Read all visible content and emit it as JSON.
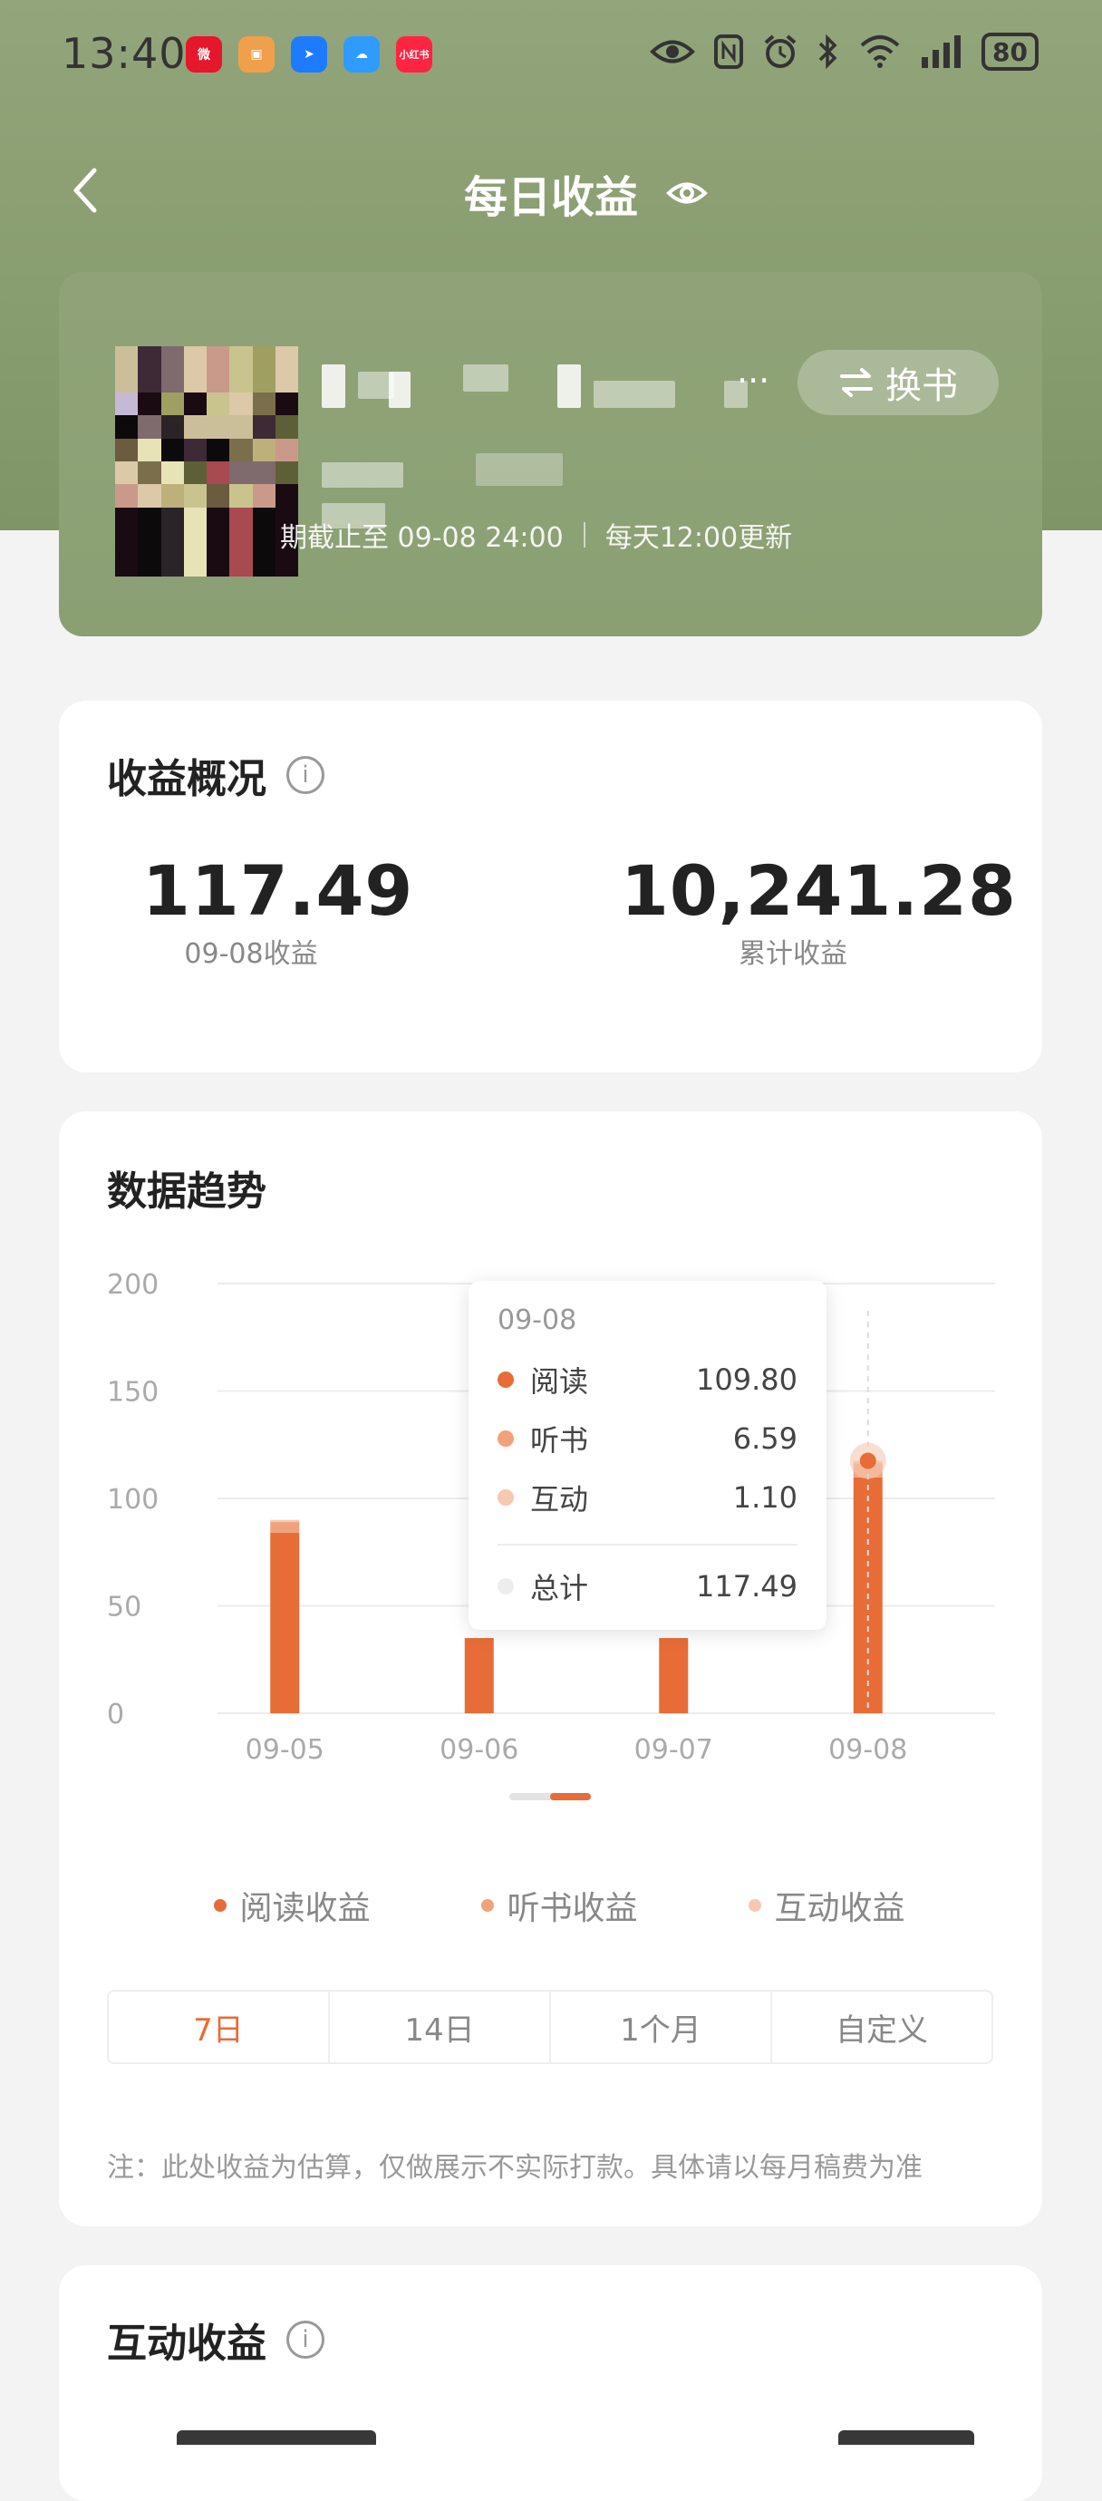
{
  "status_bar": {
    "time": "13:40",
    "battery": "80",
    "apps": [
      {
        "icon": "weibo-icon",
        "color": "#e6162d"
      },
      {
        "icon": "chat-bot-icon",
        "color": "#f0a04b"
      },
      {
        "icon": "bookmark-app-icon",
        "color": "#1e7bff"
      },
      {
        "icon": "cloud-icon",
        "color": "#2f9bff"
      },
      {
        "icon": "xiaohongshu-icon",
        "color": "#ff2442"
      }
    ],
    "indicators": [
      "eye-icon",
      "nfc-icon",
      "alarm-icon",
      "bluetooth-icon",
      "wifi-icon",
      "signal-icon"
    ]
  },
  "header": {
    "title": "每日收益"
  },
  "book": {
    "switch_label": "换书",
    "dots": "···",
    "data_cutoff": "期截止至 09-08 24:00",
    "update_note": "每天12:00更新"
  },
  "overview": {
    "title": "收益概况",
    "info": "i",
    "daily_value": "117.49",
    "daily_label": "09-08收益",
    "total_value": "10,241.28",
    "total_label": "累计收益"
  },
  "trend": {
    "title": "数据趋势",
    "tooltip": {
      "date": "09-08",
      "rows": [
        {
          "label": "阅读",
          "value": "109.80",
          "color": "#e86c37"
        },
        {
          "label": "听书",
          "value": "6.59",
          "color": "#f0a27a"
        },
        {
          "label": "互动",
          "value": "1.10",
          "color": "#f6c8b0"
        }
      ],
      "total_label": "总计",
      "total_value": "117.49",
      "total_color": "#ededed"
    },
    "legend": [
      {
        "label": "阅读收益",
        "color": "#e86c37"
      },
      {
        "label": "听书收益",
        "color": "#f0a27a"
      },
      {
        "label": "互动收益",
        "color": "#f6c8b0"
      }
    ],
    "tabs": [
      "7日",
      "14日",
      "1个月",
      "自定义"
    ],
    "active_tab": 0,
    "note": "注：此处收益为估算，仅做展示不实际打款。具体请以每月稿费为准"
  },
  "chart_data": {
    "type": "bar",
    "stacked": true,
    "categories": [
      "09-05",
      "09-06",
      "09-07",
      "09-08"
    ],
    "series": [
      {
        "name": "阅读收益",
        "values": [
          84,
          35,
          35,
          109.8
        ],
        "color": "#e86c37"
      },
      {
        "name": "听书收益",
        "values": [
          5,
          0,
          0,
          6.59
        ],
        "color": "#f0a27a"
      },
      {
        "name": "互动收益",
        "values": [
          1,
          0,
          0,
          1.1
        ],
        "color": "#f6c8b0"
      }
    ],
    "ylim": [
      0,
      200
    ],
    "yticks": [
      "0",
      "50",
      "100",
      "150",
      "200"
    ],
    "grid": true,
    "xlabel": "",
    "ylabel": "",
    "selected_category": "09-08"
  },
  "interaction": {
    "title": "互动收益",
    "info": "i"
  }
}
